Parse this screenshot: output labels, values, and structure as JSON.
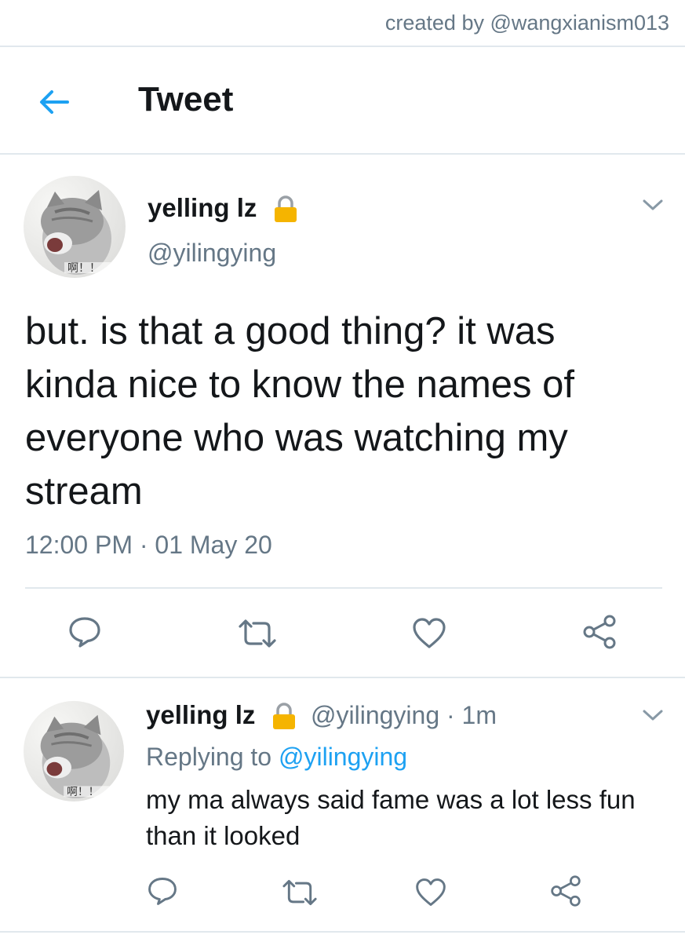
{
  "credit": "created by @wangxianism013",
  "header": {
    "title": "Tweet"
  },
  "tweet": {
    "name": "yelling lz",
    "handle": "@yilingying",
    "text": "but. is that a good thing? it was kinda nice to know the names of everyone who was watching my stream",
    "timestamp": "12:00 PM · 01 May 20",
    "avatar_caption": "啊！！"
  },
  "reply": {
    "name": "yelling lz",
    "handle": "@yilingying",
    "age": " · 1m",
    "replying_prefix": "Replying to ",
    "replying_to": "@yilingying",
    "text": "my ma always said fame was a lot less fun than it looked",
    "avatar_caption": "啊！！"
  },
  "icons": [
    "back-arrow-icon",
    "lock-icon",
    "chevron-down-icon",
    "reply-icon",
    "retweet-icon",
    "like-icon",
    "share-icon"
  ],
  "colors": {
    "accent": "#1da1f2",
    "muted": "#657786",
    "text": "#14171a",
    "divider": "#e1e8ed",
    "lock": "#f5b400"
  }
}
